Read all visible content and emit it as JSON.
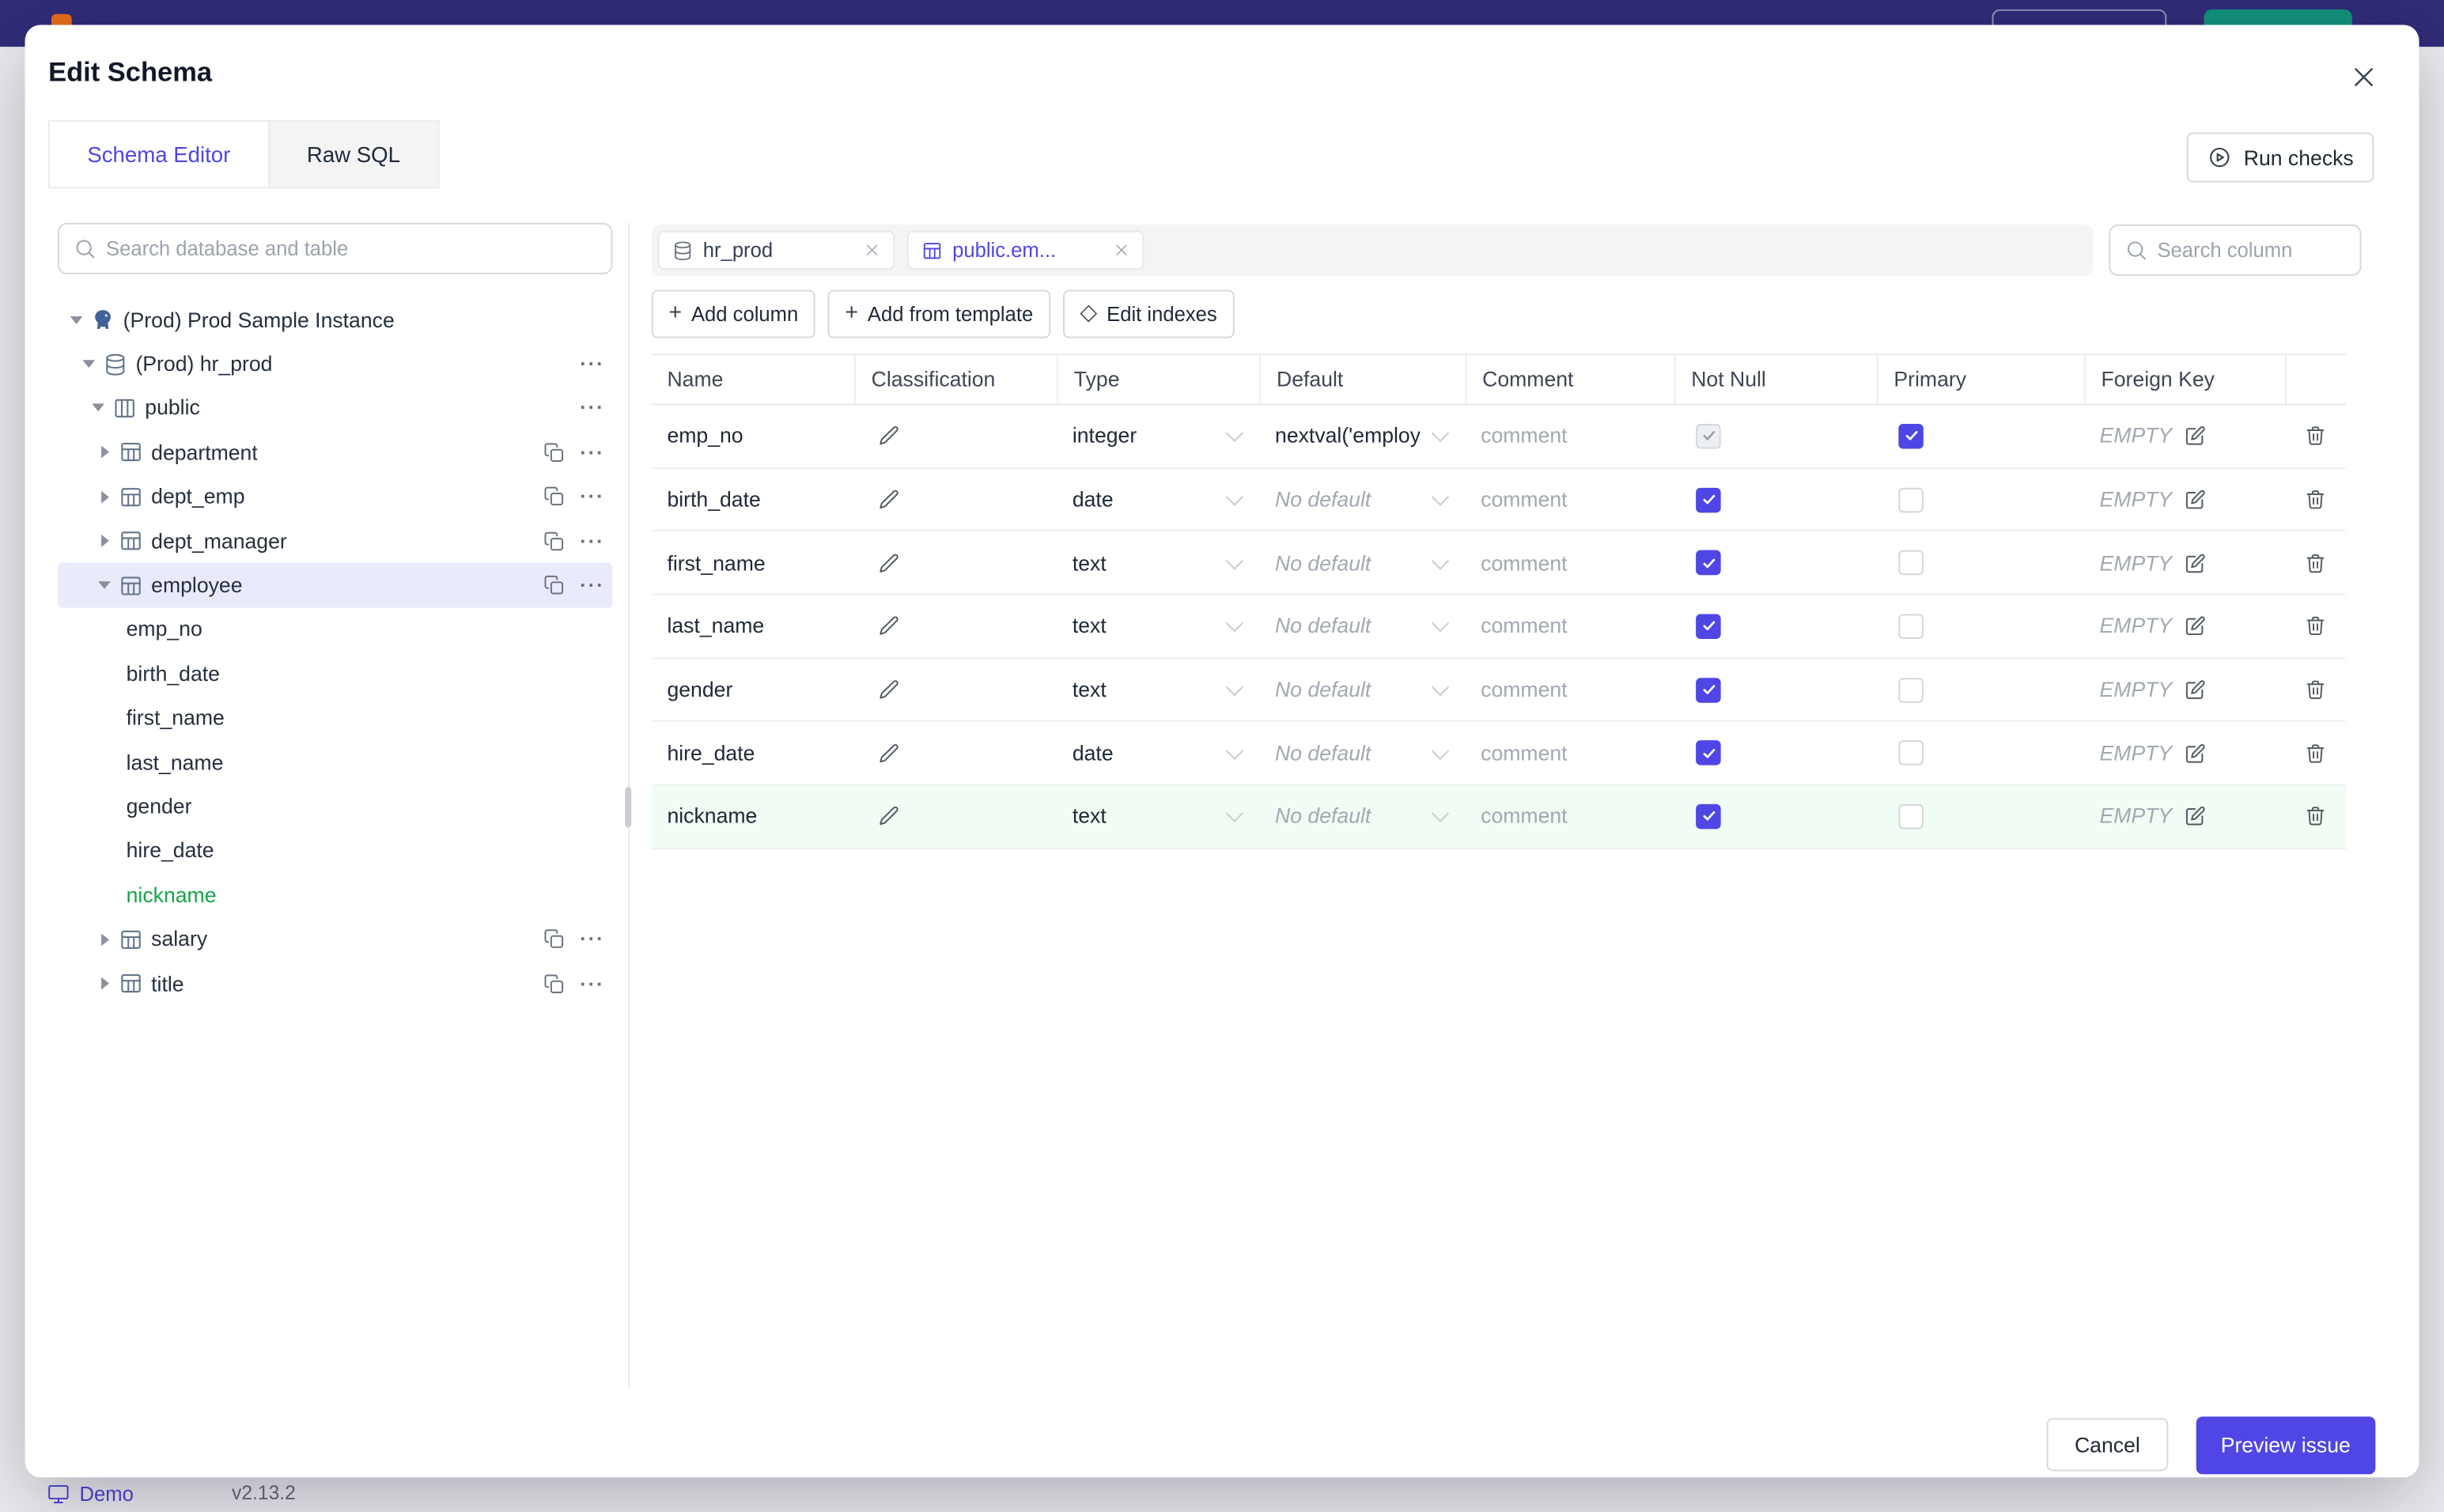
{
  "colors": {
    "accent": "#4f46e5",
    "added_green": "#16a34a",
    "added_row_bg": "#f1fcf4",
    "topbar": "#322e7d",
    "teal_button": "#129d80",
    "selected_tree_bg": "#e9ebfb",
    "muted_text": "#9ca3af"
  },
  "statusbar": {
    "brand": "Demo",
    "version": "v2.13.2"
  },
  "modal": {
    "title": "Edit Schema",
    "tabs": [
      {
        "label": "Schema Editor",
        "active": true
      },
      {
        "label": "Raw SQL",
        "active": false
      }
    ],
    "run_checks_label": "Run checks",
    "footer": {
      "cancel_label": "Cancel",
      "submit_label": "Preview issue"
    }
  },
  "sidebar": {
    "search_placeholder": "Search database and table",
    "tree": [
      {
        "label": "(Prod) Prod Sample Instance",
        "level": 0,
        "icon": "instance",
        "caret": "down"
      },
      {
        "label": "(Prod) hr_prod",
        "level": 1,
        "icon": "database",
        "caret": "down",
        "more": true
      },
      {
        "label": "public",
        "level": 2,
        "icon": "schema",
        "caret": "down",
        "more": true
      },
      {
        "label": "department",
        "level": 3,
        "icon": "table",
        "caret": "right",
        "copy": true,
        "more": true
      },
      {
        "label": "dept_emp",
        "level": 3,
        "icon": "table",
        "caret": "right",
        "copy": true,
        "more": true
      },
      {
        "label": "dept_manager",
        "level": 3,
        "icon": "table",
        "caret": "right",
        "copy": true,
        "more": true
      },
      {
        "label": "employee",
        "level": 3,
        "icon": "table",
        "caret": "down",
        "copy": true,
        "more": true,
        "selected": true
      },
      {
        "label": "emp_no",
        "level": 4,
        "column": true
      },
      {
        "label": "birth_date",
        "level": 4,
        "column": true
      },
      {
        "label": "first_name",
        "level": 4,
        "column": true
      },
      {
        "label": "last_name",
        "level": 4,
        "column": true
      },
      {
        "label": "gender",
        "level": 4,
        "column": true
      },
      {
        "label": "hire_date",
        "level": 4,
        "column": true
      },
      {
        "label": "nickname",
        "level": 4,
        "column": true,
        "added": true
      },
      {
        "label": "salary",
        "level": 3,
        "icon": "table",
        "caret": "right",
        "copy": true,
        "more": true
      },
      {
        "label": "title",
        "level": 3,
        "icon": "table",
        "caret": "right",
        "copy": true,
        "more": true
      }
    ]
  },
  "main": {
    "chips": [
      {
        "label": "hr_prod",
        "icon": "database",
        "active": false
      },
      {
        "label": "public.em...",
        "icon": "table",
        "active": true
      }
    ],
    "column_search_placeholder": "Search column",
    "toolbar": [
      {
        "label": "Add column",
        "icon": "plus"
      },
      {
        "label": "Add from template",
        "icon": "plus"
      },
      {
        "label": "Edit indexes",
        "icon": "diamond"
      }
    ],
    "table": {
      "headers": [
        "Name",
        "Classification",
        "Type",
        "Default",
        "Comment",
        "Not Null",
        "Primary",
        "Foreign Key"
      ],
      "comment_placeholder": "comment",
      "no_default_label": "No default",
      "foreign_key_empty": "EMPTY",
      "rows": [
        {
          "name": "emp_no",
          "type": "integer",
          "default": "nextval('employ",
          "has_default": true,
          "not_null": true,
          "not_null_disabled": true,
          "primary": true,
          "added": false
        },
        {
          "name": "birth_date",
          "type": "date",
          "has_default": false,
          "not_null": true,
          "primary": false,
          "added": false
        },
        {
          "name": "first_name",
          "type": "text",
          "has_default": false,
          "not_null": true,
          "primary": false,
          "added": false
        },
        {
          "name": "last_name",
          "type": "text",
          "has_default": false,
          "not_null": true,
          "primary": false,
          "added": false
        },
        {
          "name": "gender",
          "type": "text",
          "has_default": false,
          "not_null": true,
          "primary": false,
          "added": false
        },
        {
          "name": "hire_date",
          "type": "date",
          "has_default": false,
          "not_null": true,
          "primary": false,
          "added": false
        },
        {
          "name": "nickname",
          "type": "text",
          "has_default": false,
          "not_null": true,
          "primary": false,
          "added": true
        }
      ]
    }
  }
}
